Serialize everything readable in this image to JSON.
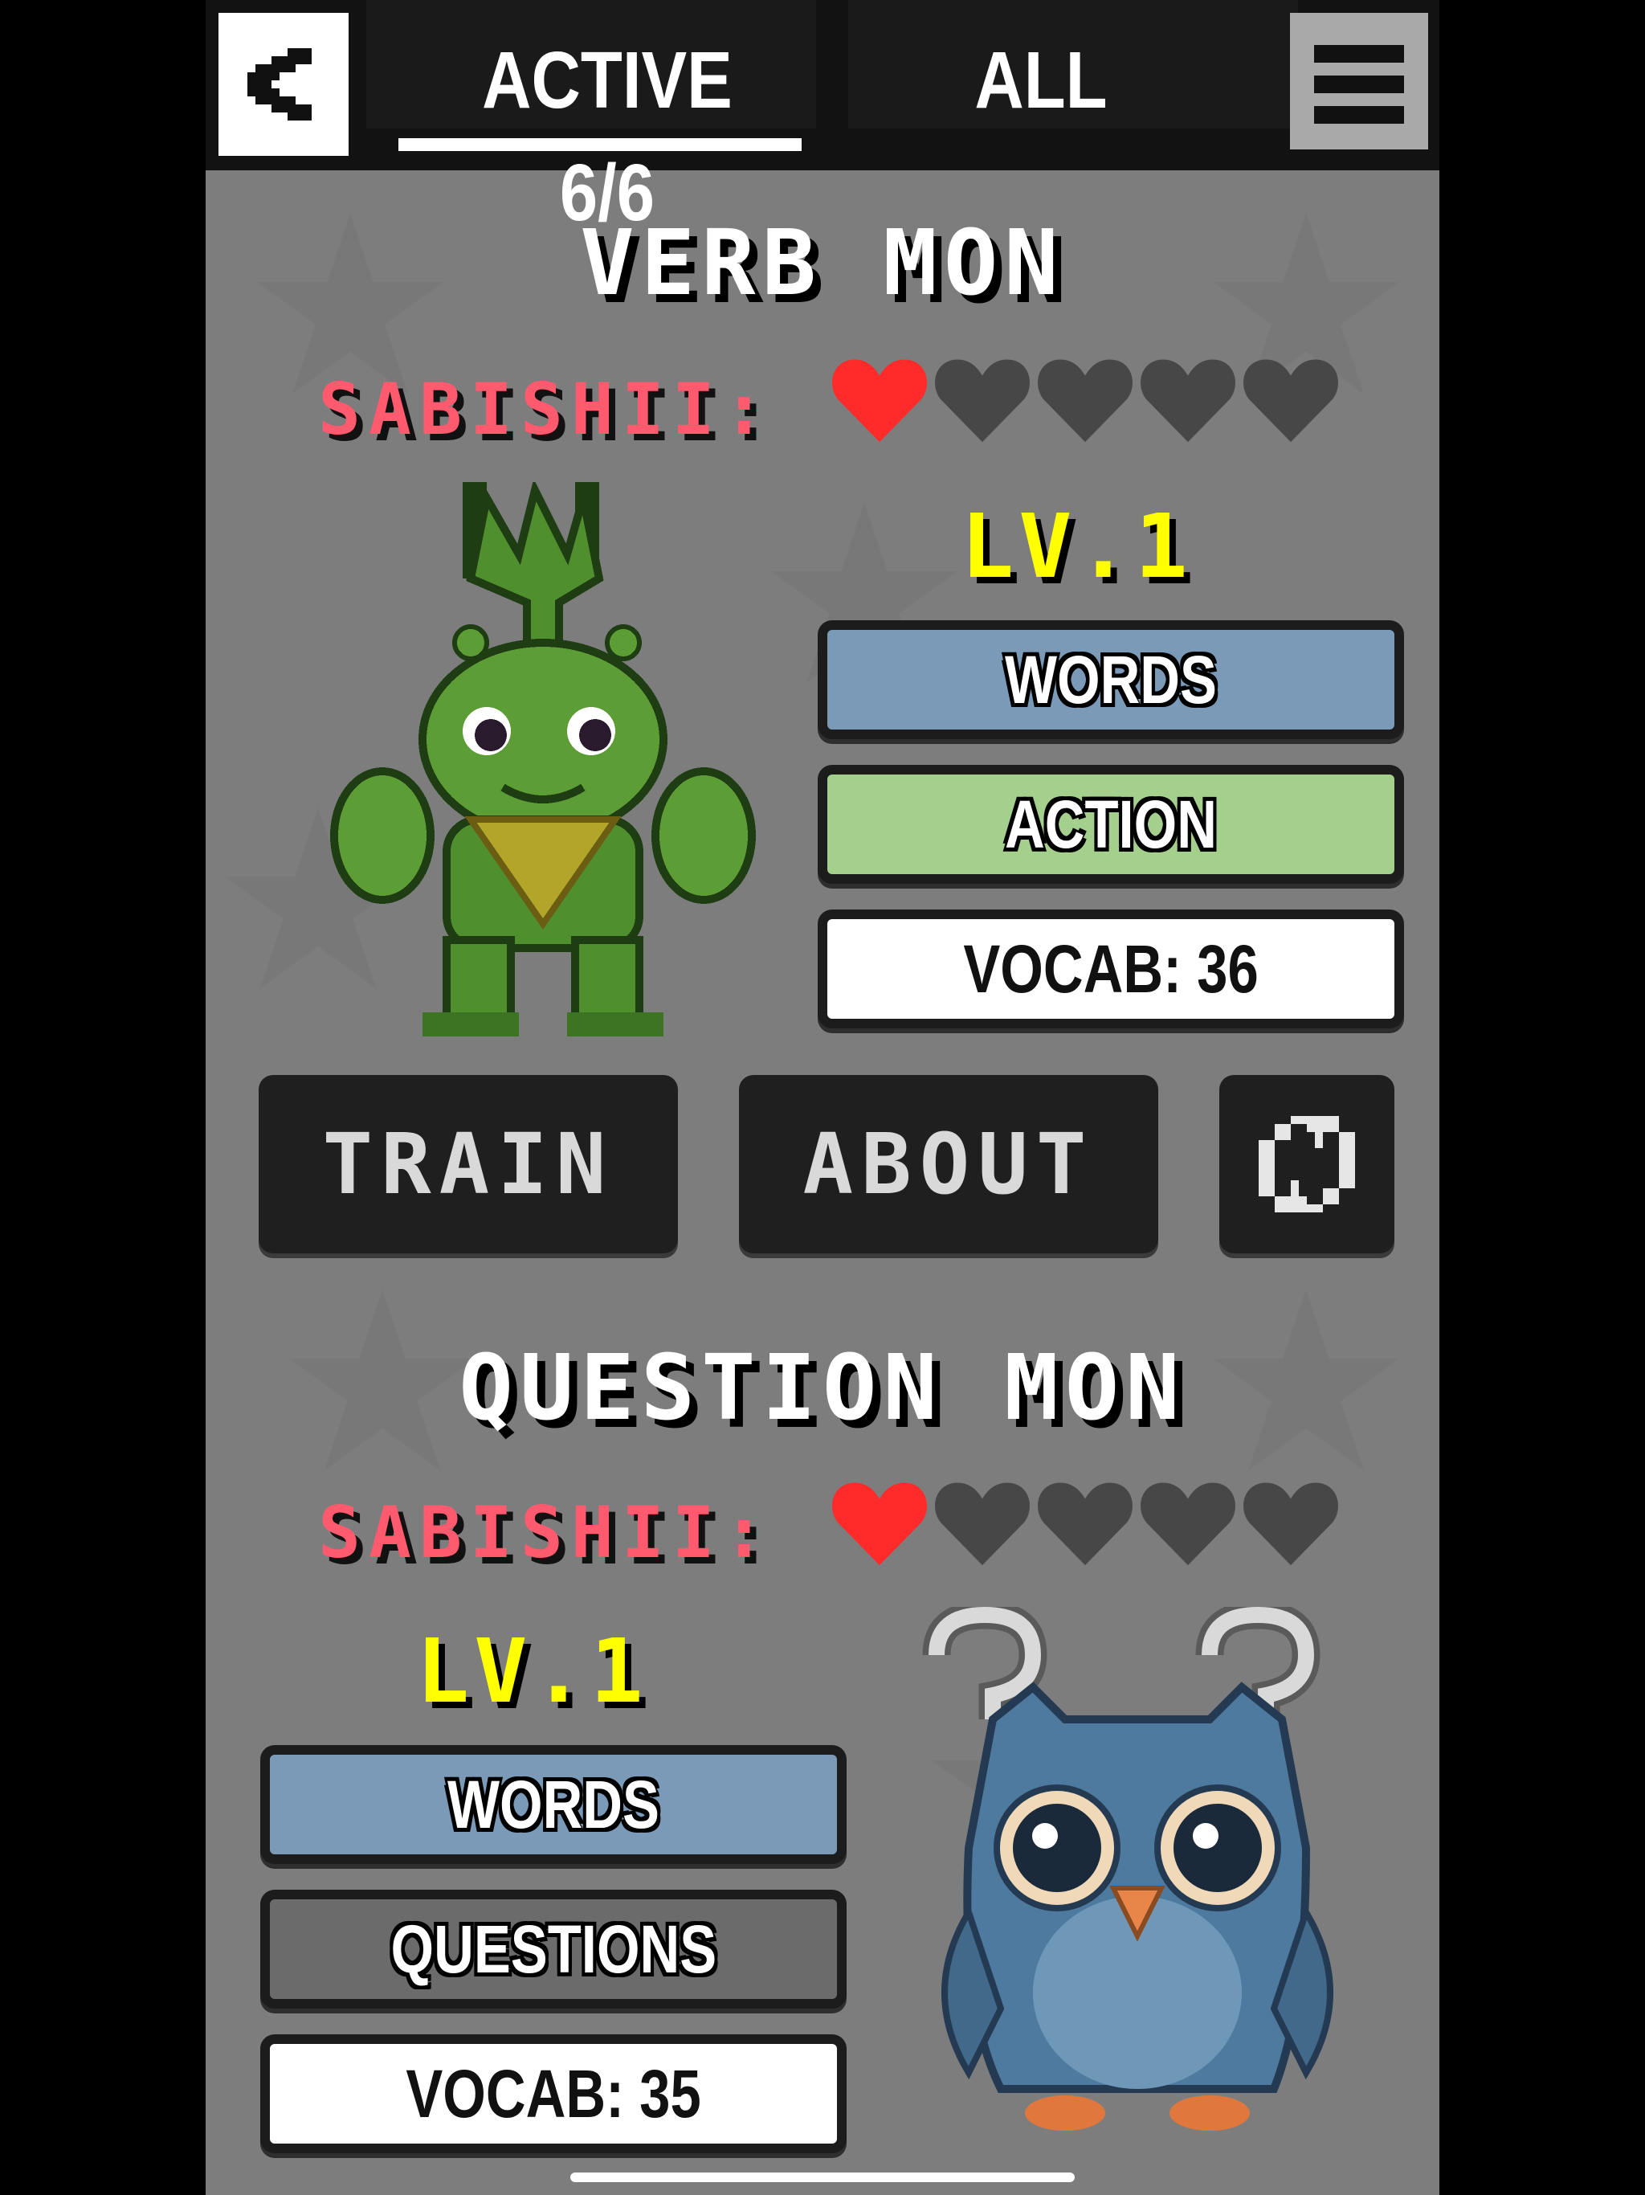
{
  "header": {
    "back_icon": "chevron-left-icon",
    "tab_active_label": "ACTIVE 6/6",
    "tab_all_label": "ALL",
    "menu_icon": "hamburger-menu-icon"
  },
  "mons": [
    {
      "name": "VERB MON",
      "sabishii_label": "SABISHII:",
      "hearts_filled": 1,
      "hearts_total": 5,
      "level": "LV.1",
      "tags": [
        "WORDS",
        "ACTION"
      ],
      "vocab": "VOCAB: 36",
      "sprite": "green-beetle-creature",
      "buttons": {
        "train": "TRAIN",
        "about": "ABOUT",
        "swap_icon": "swap-arrows-icon"
      }
    },
    {
      "name": "QUESTION MON",
      "sabishii_label": "SABISHII:",
      "hearts_filled": 1,
      "hearts_total": 5,
      "level": "LV.1",
      "tags": [
        "WORDS",
        "QUESTIONS"
      ],
      "vocab": "VOCAB: 35",
      "sprite": "blue-owl-creature"
    }
  ],
  "colors": {
    "heart_filled": "#ff2a2a",
    "heart_empty": "#474747",
    "sabishii": "#ff5a6e",
    "level": "#ffff00",
    "tag_words": "#7b9ab8",
    "tag_action": "#a5cf8c",
    "tag_questions": "#6b6b6b"
  }
}
